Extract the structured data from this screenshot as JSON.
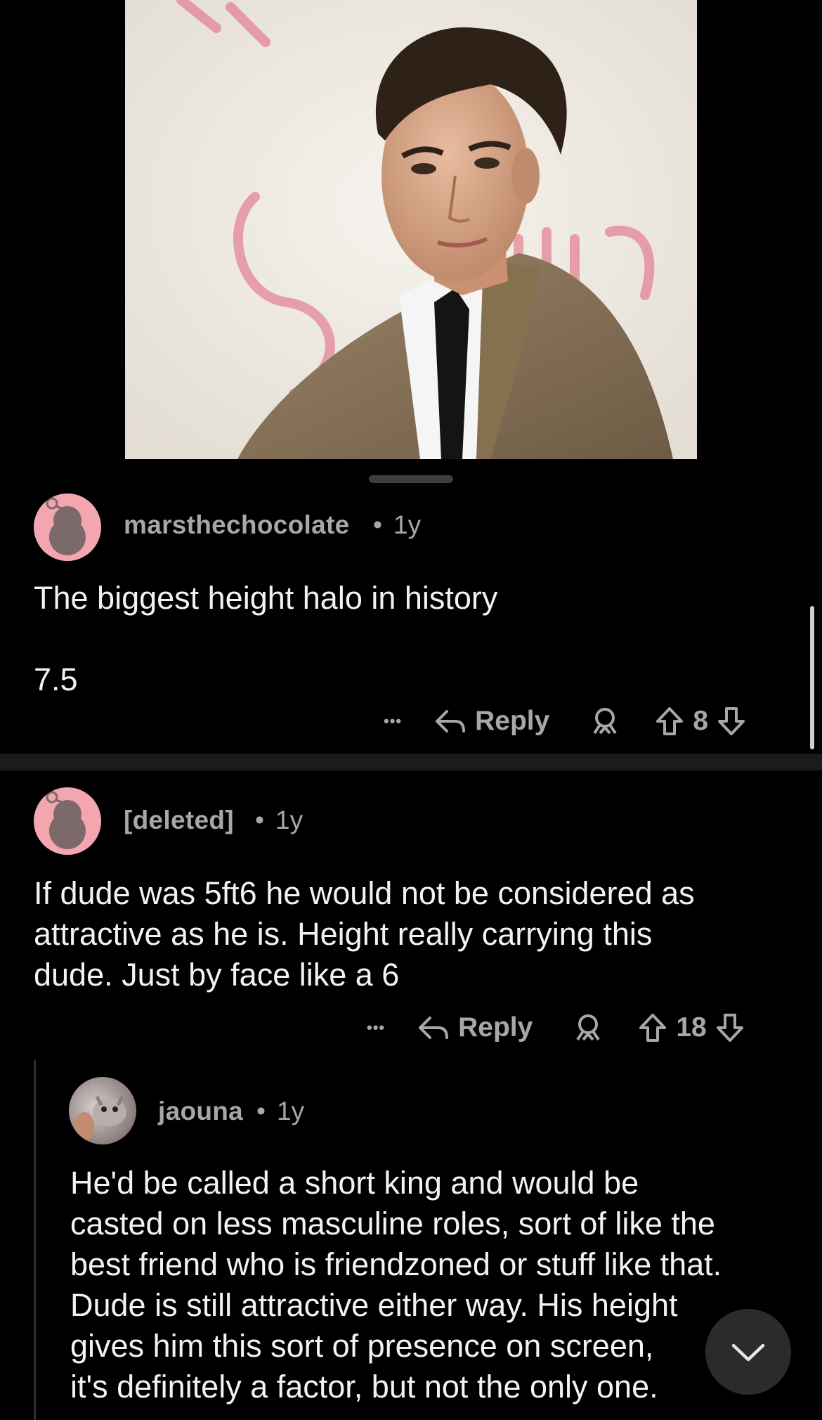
{
  "comments": [
    {
      "username": "marsthechocolate",
      "separator": "•",
      "age": "1y",
      "body": "The biggest height halo in history\n\n7.5",
      "more_label": "•••",
      "reply_label": "Reply",
      "votes": "8"
    },
    {
      "username": "[deleted]",
      "separator": "•",
      "age": "1y",
      "body": "If dude was 5ft6 he would not be considered as\nattractive as he is. Height really carrying this\ndude. Just by face like a 6",
      "more_label": "•••",
      "reply_label": "Reply",
      "votes": "18"
    },
    {
      "username": "jaouna",
      "separator": "•",
      "age": "1y",
      "body": "He'd be called a short king and would be\ncasted on less masculine roles, sort of like the\nbest friend who is friendzoned or stuff like that.\nDude is still attractive either way. His height\ngives him this sort of presence on screen,\nit's definitely a factor, but not the only one."
    }
  ],
  "icons": {
    "more": "more-dots-icon",
    "reply": "reply-arrow-icon",
    "award": "award-icon",
    "upvote": "upvote-arrow-icon",
    "downvote": "downvote-arrow-icon",
    "collapse": "chevron-down-icon"
  },
  "colors": {
    "background": "#000000",
    "meta_text": "#a7a7a7",
    "body_text": "#f2f2f2",
    "snoo_avatar_bg": "#f4a6b0"
  }
}
